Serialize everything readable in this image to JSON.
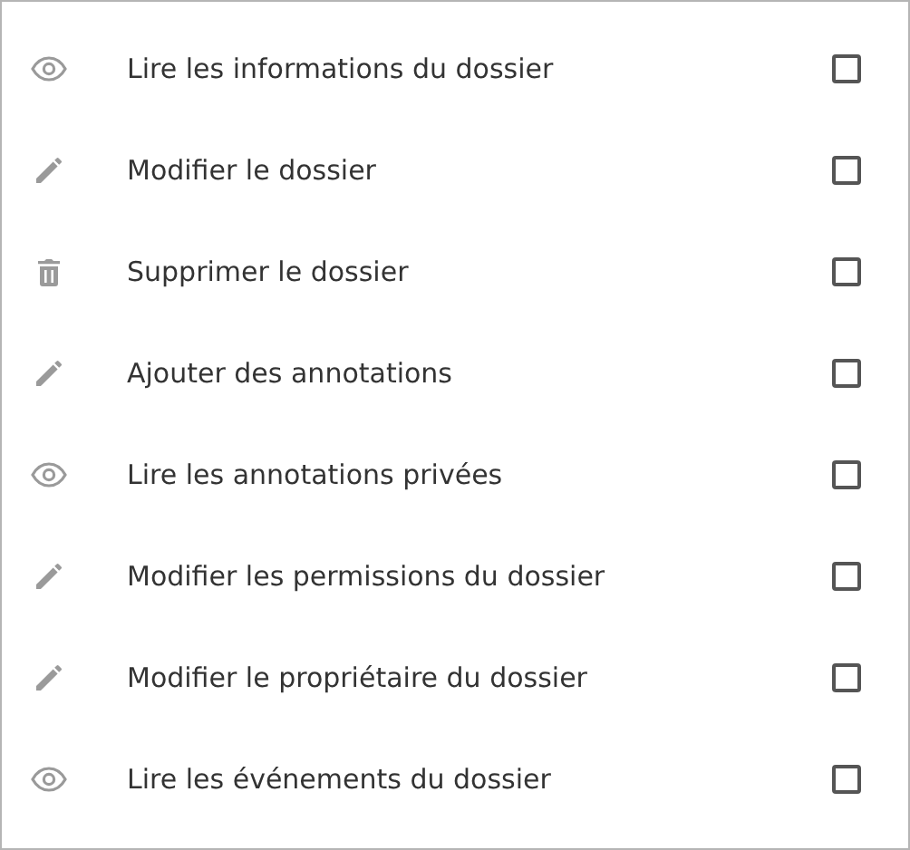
{
  "permissions": [
    {
      "kind": "view",
      "label": "Lire les informations du dossier",
      "checked": false
    },
    {
      "kind": "edit",
      "label": "Modifier le dossier",
      "checked": false
    },
    {
      "kind": "delete",
      "label": "Supprimer le dossier",
      "checked": false
    },
    {
      "kind": "edit",
      "label": "Ajouter des annotations",
      "checked": false
    },
    {
      "kind": "view",
      "label": "Lire les annotations privées",
      "checked": false
    },
    {
      "kind": "edit",
      "label": "Modifier les permissions du dossier",
      "checked": false
    },
    {
      "kind": "edit",
      "label": "Modifier le propriétaire du dossier",
      "checked": false
    },
    {
      "kind": "view",
      "label": "Lire les événements du dossier",
      "checked": false
    }
  ]
}
